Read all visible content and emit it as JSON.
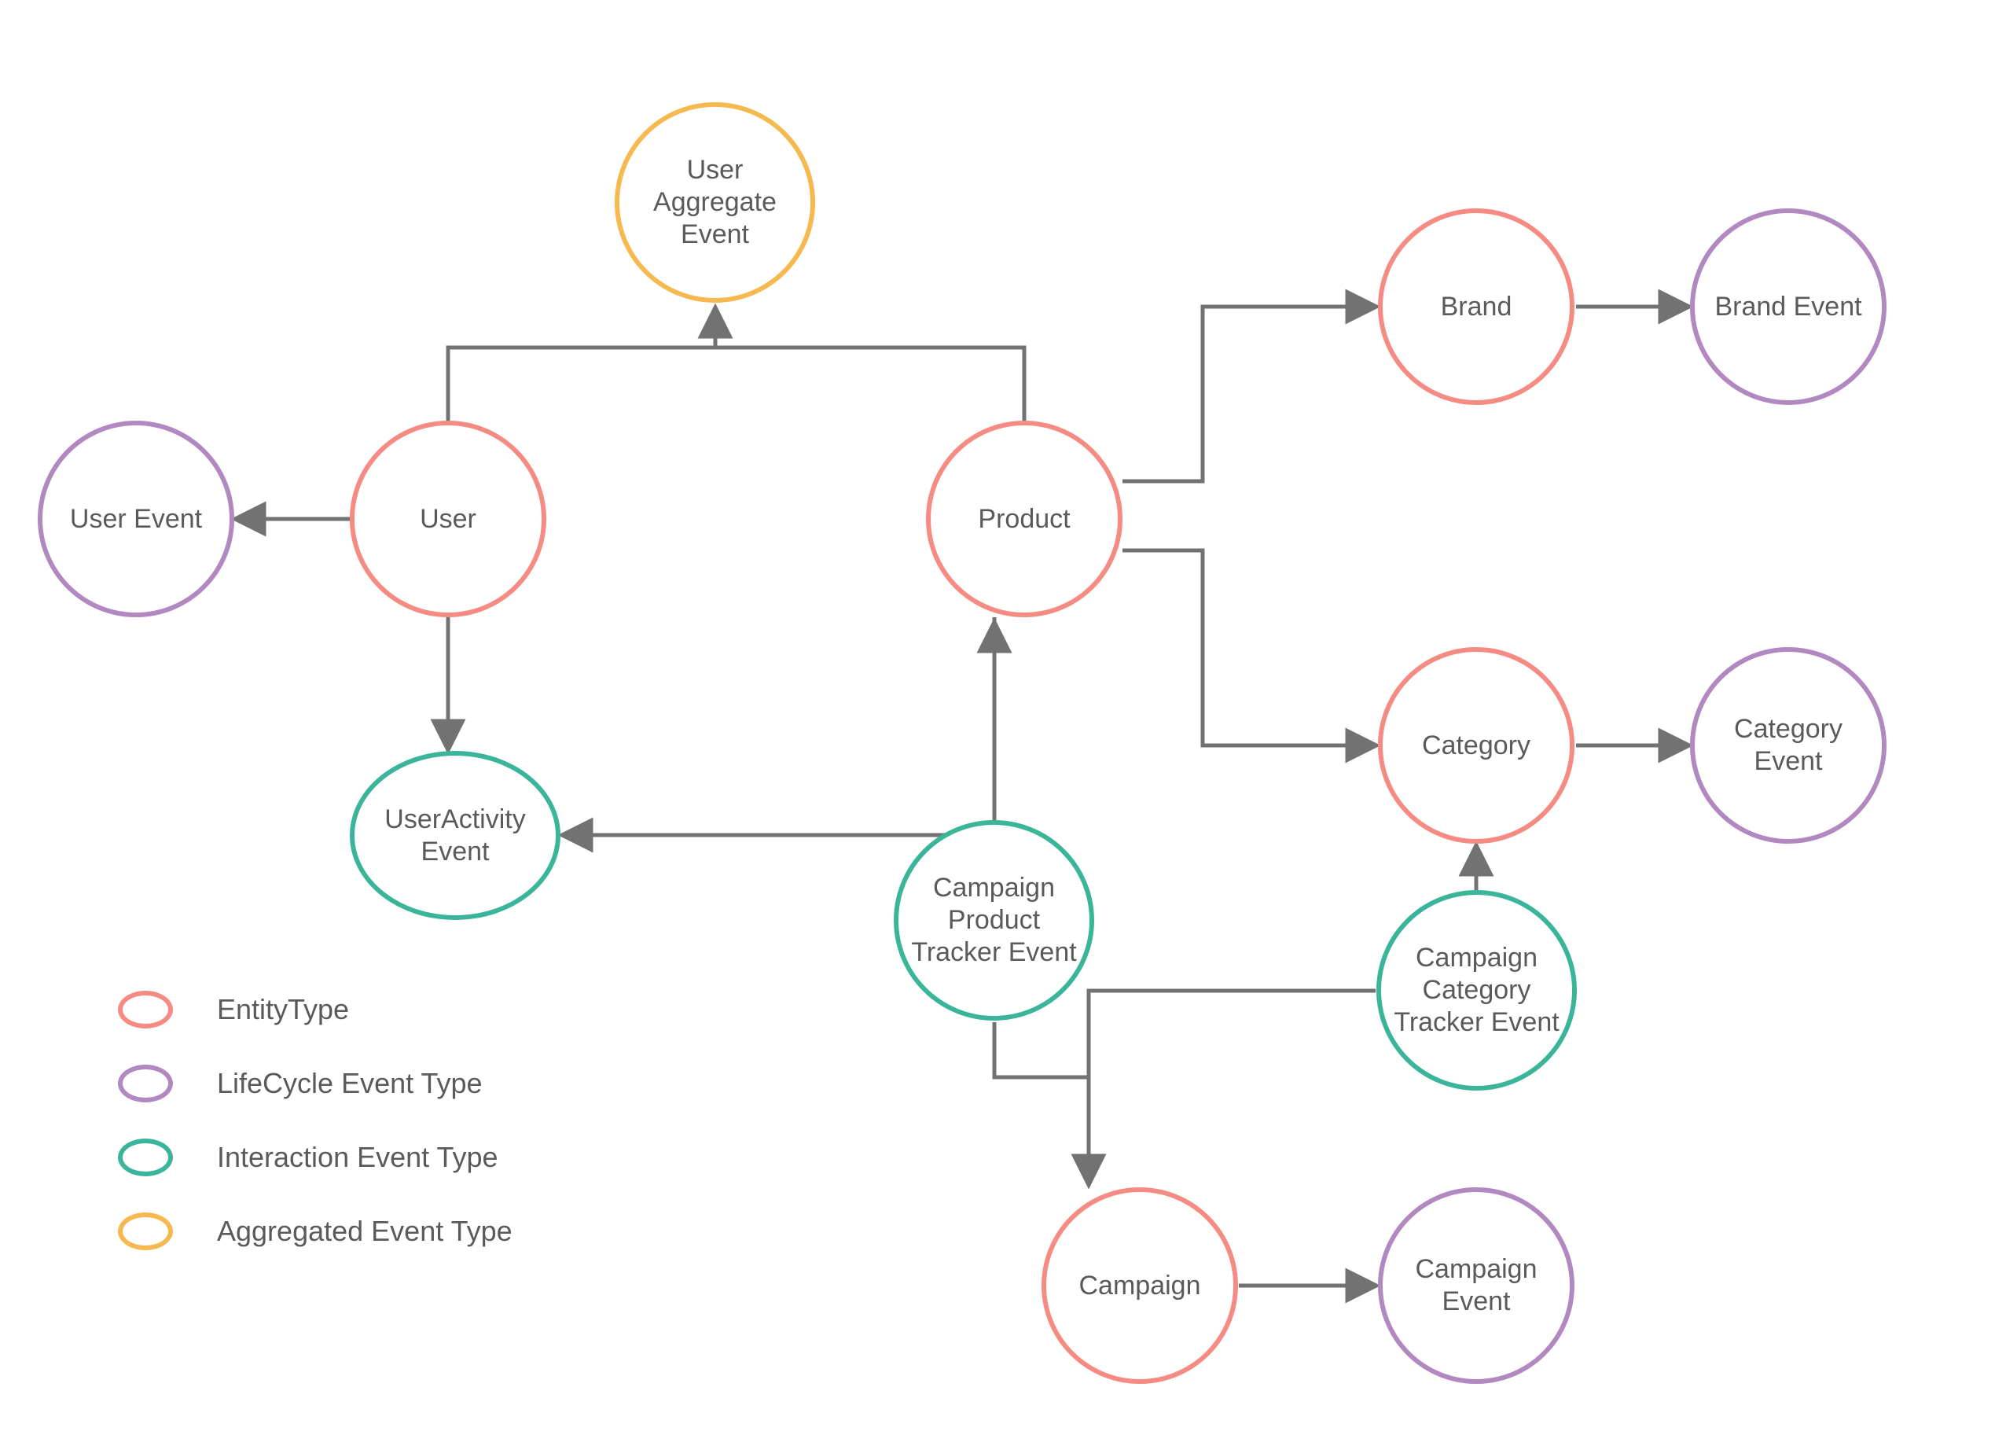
{
  "colors": {
    "entity": "#f58b82",
    "lifecycle": "#b288c0",
    "interaction": "#3bb59a",
    "aggregated": "#f5b94f",
    "edge": "#727272",
    "text": "#5a5a5a"
  },
  "nodes": {
    "user_aggregate_event": {
      "label": "User Aggregate Event",
      "type": "aggregated"
    },
    "user": {
      "label": "User",
      "type": "entity"
    },
    "user_event": {
      "label": "User Event",
      "type": "lifecycle"
    },
    "user_activity_event": {
      "label": "UserActivity Event",
      "type": "interaction"
    },
    "product": {
      "label": "Product",
      "type": "entity"
    },
    "brand": {
      "label": "Brand",
      "type": "entity"
    },
    "brand_event": {
      "label": "Brand Event",
      "type": "lifecycle"
    },
    "category": {
      "label": "Category",
      "type": "entity"
    },
    "category_event": {
      "label": "Category Event",
      "type": "lifecycle"
    },
    "campaign_product_tracker_event": {
      "label": "Campaign Product Tracker Event",
      "type": "interaction"
    },
    "campaign_category_tracker_event": {
      "label": "Campaign Category Tracker Event",
      "type": "interaction"
    },
    "campaign": {
      "label": "Campaign",
      "type": "entity"
    },
    "campaign_event": {
      "label": "Campaign Event",
      "type": "lifecycle"
    }
  },
  "legend": [
    {
      "type": "entity",
      "label": "EntityType"
    },
    {
      "type": "lifecycle",
      "label": "LifeCycle Event Type"
    },
    {
      "type": "interaction",
      "label": "Interaction Event Type"
    },
    {
      "type": "aggregated",
      "label": "Aggregated Event Type"
    }
  ],
  "edges": [
    {
      "from": "user",
      "to": "user_event"
    },
    {
      "from": "user",
      "to": "user_activity_event"
    },
    {
      "from": "user",
      "to": "user_aggregate_event"
    },
    {
      "from": "product",
      "to": "user_aggregate_event"
    },
    {
      "from": "product",
      "to": "user_activity_event"
    },
    {
      "from": "product",
      "to": "brand"
    },
    {
      "from": "product",
      "to": "category"
    },
    {
      "from": "brand",
      "to": "brand_event"
    },
    {
      "from": "category",
      "to": "category_event"
    },
    {
      "from": "campaign_product_tracker_event",
      "to": "product"
    },
    {
      "from": "campaign_product_tracker_event",
      "to": "campaign"
    },
    {
      "from": "campaign_category_tracker_event",
      "to": "category"
    },
    {
      "from": "campaign_category_tracker_event",
      "to": "campaign"
    },
    {
      "from": "campaign",
      "to": "campaign_event"
    }
  ]
}
